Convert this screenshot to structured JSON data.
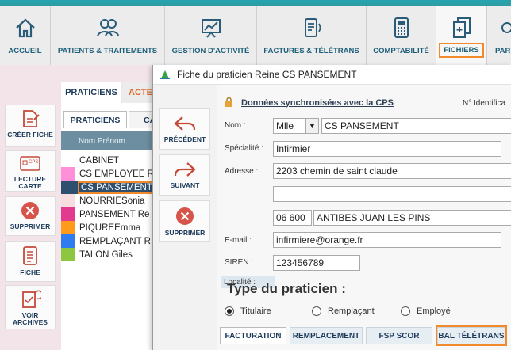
{
  "nav": {
    "items": [
      {
        "label": "ACCUEIL",
        "icon": "home-icon"
      },
      {
        "label": "PATIENTS & TRAITEMENTS",
        "icon": "patients-icon"
      },
      {
        "label": "GESTION D'ACTIVITÉ",
        "icon": "chart-board-icon"
      },
      {
        "label": "FACTURES & TÉLÉTRANS",
        "icon": "invoice-icon"
      },
      {
        "label": "COMPTABILITÉ",
        "icon": "calculator-icon"
      },
      {
        "label": "FICHIERS",
        "icon": "files-icon"
      },
      {
        "label": "PAR",
        "icon": "settings-icon"
      }
    ],
    "active": "FICHIERS"
  },
  "left_actions": [
    {
      "label": "CRÉER FICHE",
      "icon": "create-file-icon"
    },
    {
      "label": "LECTURE CARTE",
      "icon": "cps-card-icon"
    },
    {
      "label": "SUPPRIMER",
      "icon": "delete-icon"
    },
    {
      "label": "FICHE",
      "icon": "document-icon"
    },
    {
      "label": "VOIR ARCHIVES",
      "icon": "archive-icon"
    }
  ],
  "tabs": {
    "praticiens": "PRATICIENS",
    "actes": "ACTES"
  },
  "subtabs": {
    "praticiens": "PRATICIENS",
    "other": "CA"
  },
  "list": {
    "header": "Nom Prénom",
    "rows": [
      {
        "name": "CABINET",
        "color": "#ffffff"
      },
      {
        "name": "CS EMPLOYEE R",
        "color": "#ff8fd8"
      },
      {
        "name": "CS PANSEMENT",
        "color": "#2e4f6e"
      },
      {
        "name": "NOURRIESonia",
        "color": "#f7dede"
      },
      {
        "name": "PANSEMENT Re",
        "color": "#e23a8e"
      },
      {
        "name": "PIQUREEmma",
        "color": "#ff9a1a"
      },
      {
        "name": "REMPLAÇANT R",
        "color": "#2f7bf0"
      },
      {
        "name": "TALON Giles",
        "color": "#8dc63f"
      }
    ]
  },
  "dialog": {
    "title": "Fiche du praticien Reine CS PANSEMENT",
    "actions": [
      {
        "label": "PRÉCÉDENT",
        "icon": "previous-arrow-icon"
      },
      {
        "label": "SUIVANT",
        "icon": "next-arrow-icon"
      },
      {
        "label": "SUPPRIMER",
        "icon": "delete-icon"
      }
    ],
    "sync_text": "Données synchronisées avec la CPS",
    "identif_label": "N° Identifica",
    "fields": {
      "nom_label": "Nom :",
      "civilite": "Mlle",
      "nom": "CS PANSEMENT",
      "specialite_label": "Spécialité :",
      "specialite": "Infirmier",
      "adresse_label": "Adresse :",
      "adresse1": "2203 chemin de saint claude",
      "adresse2": "",
      "localite_label": "Localité :",
      "code_postal": "06 600",
      "ville": "ANTIBES JUAN LES PINS",
      "email_label": "E-mail :",
      "email": "infirmiere@orange.fr",
      "siren_label": "SIREN :",
      "siren": "123456789"
    },
    "type_title": "Type du praticien :",
    "types": [
      {
        "label": "Titulaire",
        "checked": true
      },
      {
        "label": "Remplaçant",
        "checked": false
      },
      {
        "label": "Employé",
        "checked": false
      }
    ],
    "bottom_tabs": [
      "FACTURATION",
      "REMPLACEMENT",
      "FSP SCOR",
      "BAL TÉLÉTRANS"
    ]
  }
}
